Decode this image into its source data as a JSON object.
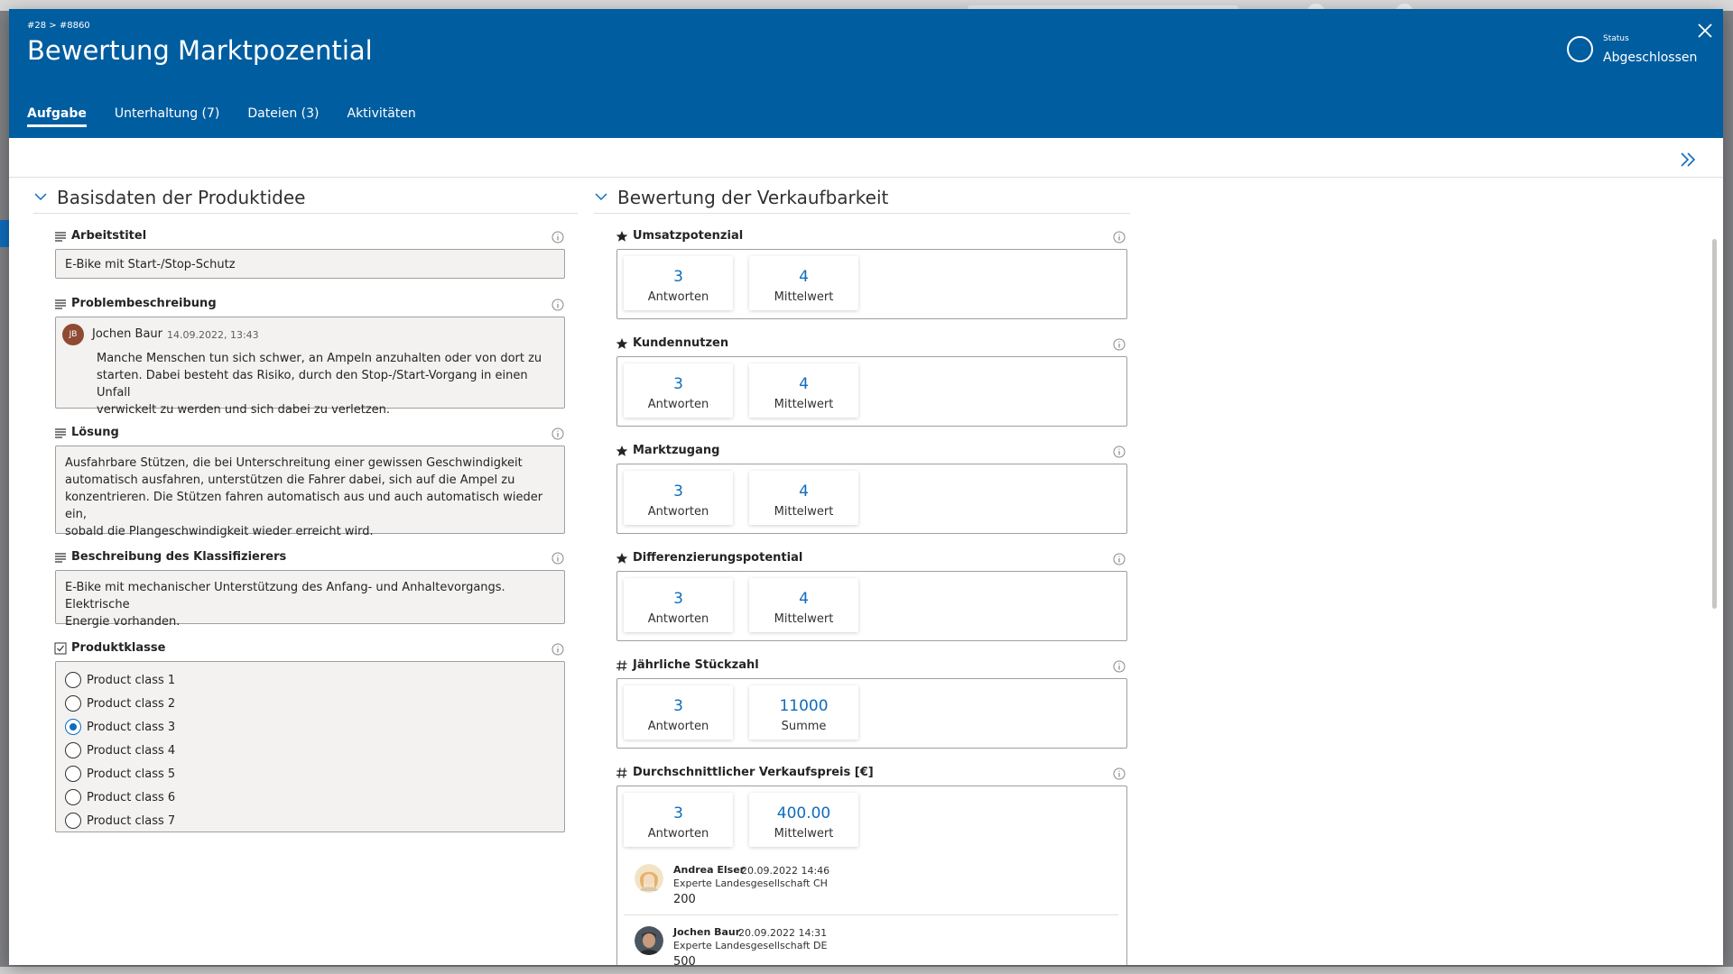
{
  "header": {
    "breadcrumb": "#28 >  #8860",
    "title": "Bewertung Marktpozential",
    "status_label": "Status",
    "status_value": "Abgeschlossen",
    "close_icon": "close-icon"
  },
  "tabs": [
    {
      "label": "Aufgabe",
      "active": true
    },
    {
      "label": "Unterhaltung (7)",
      "active": false
    },
    {
      "label": "Dateien (3)",
      "active": false
    },
    {
      "label": "Aktivitäten",
      "active": false
    }
  ],
  "left_section": {
    "title": "Basisdaten der Produktidee",
    "arbeitstitel": {
      "label": "Arbeitstitel",
      "value": "E-Bike mit Start-/Stop-Schutz"
    },
    "problem": {
      "label": "Problembeschreibung",
      "author_initials": "JB",
      "author": "Jochen Baur",
      "timestamp": "14.09.2022, 13:43",
      "text_lines": [
        "Manche Menschen tun sich schwer, an Ampeln anzuhalten oder von dort zu",
        "starten. Dabei besteht das Risiko, durch den Stop-/Start-Vorgang in einen Unfall",
        "verwickelt zu werden und sich dabei zu verletzen."
      ]
    },
    "loesung": {
      "label": "Lösung",
      "text_lines": [
        "Ausfahrbare Stützen, die bei Unterschreitung einer gewissen Geschwindigkeit",
        "automatisch ausfahren, unterstützen die Fahrer dabei, sich auf die Ampel zu",
        "konzentrieren. Die Stützen fahren automatisch aus und auch automatisch wieder ein,",
        "sobald die Plangeschwindigkeit wieder erreicht wird."
      ]
    },
    "klassifizierer": {
      "label": "Beschreibung des Klassifizierers",
      "text_lines": [
        "E-Bike mit mechanischer Unterstützung des Anfang- und Anhaltevorgangs. Elektrische",
        "Energie vorhanden."
      ]
    },
    "produktklasse": {
      "label": "Produktklasse",
      "options": [
        "Product class 1",
        "Product class 2",
        "Product class 3",
        "Product class 4",
        "Product class 5",
        "Product class 6",
        "Product class 7"
      ],
      "selected_index": 2
    }
  },
  "right_section": {
    "title": "Bewertung der Verkaufbarkeit",
    "criteria": [
      {
        "label": "Umsatzpotenzial",
        "icon": "star-icon",
        "count": "3",
        "count_caption": "Antworten",
        "agg": "4",
        "agg_caption": "Mittelwert"
      },
      {
        "label": "Kundennutzen",
        "icon": "star-icon",
        "count": "3",
        "count_caption": "Antworten",
        "agg": "4",
        "agg_caption": "Mittelwert"
      },
      {
        "label": "Marktzugang",
        "icon": "star-icon",
        "count": "3",
        "count_caption": "Antworten",
        "agg": "4",
        "agg_caption": "Mittelwert"
      },
      {
        "label": "Differenzierungspotential",
        "icon": "star-icon",
        "count": "3",
        "count_caption": "Antworten",
        "agg": "4",
        "agg_caption": "Mittelwert"
      },
      {
        "label": "Jährliche Stückzahl",
        "icon": "hash-icon",
        "count": "3",
        "count_caption": "Antworten",
        "agg": "11000",
        "agg_caption": "Summe"
      },
      {
        "label": "Durchschnittlicher Verkaufspreis [€]",
        "icon": "hash-icon",
        "count": "3",
        "count_caption": "Antworten",
        "agg": "400.00",
        "agg_caption": "Mittelwert"
      }
    ],
    "responses": [
      {
        "name": "Andrea Elser",
        "date": "20.09.2022 14:46",
        "role": "Experte Landesgesellschaft CH",
        "value": "200"
      },
      {
        "name": "Jochen Baur",
        "date": "20.09.2022 14:31",
        "role": "Experte Landesgesellschaft DE",
        "value": "500"
      }
    ]
  },
  "colors": {
    "header": "#005da0",
    "accent": "#0f6cbd"
  }
}
